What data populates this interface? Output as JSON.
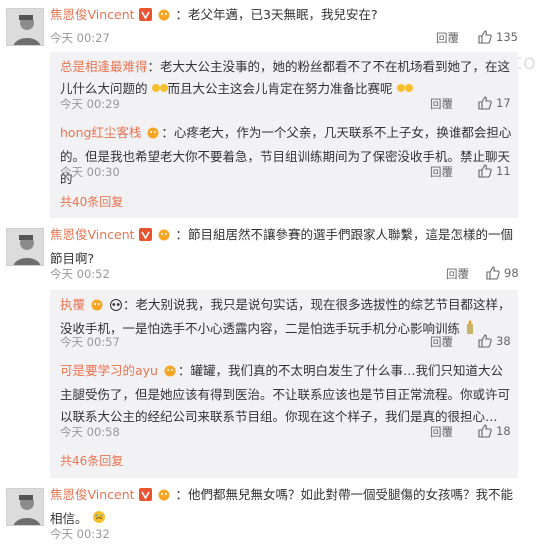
{
  "watermark": "tangchaowangyuechc.top",
  "labels": {
    "reply": "回覆"
  },
  "comments": [
    {
      "user": "焦恩俊Vincent",
      "text": "：老父年邁，已3天無眠，我兒安在?",
      "time": "今天 00:27",
      "likes": "135",
      "replies": [
        {
          "user": "总是相逢最难得",
          "text": "：老大大公主没事的，她的粉丝都看不了不在机场看到她了，在这儿什么大问题的",
          "text2": "而且大公主这会儿肯定在努力准备比赛呢",
          "time": "今天 00:29",
          "likes": "17"
        },
        {
          "user": "hong红尘客栈",
          "text": "：心疼老大，作为一个父亲，几天联系不上子女，换谁都会担心的。但是我也希望老大你不要着急，节目组训练期间为了保密没收手机。禁止聊天的",
          "time": "今天 00:30",
          "likes": "11"
        }
      ],
      "more": "共40条回复"
    },
    {
      "user": "焦恩俊Vincent",
      "text": "：節目組居然不讓參賽的選手們跟家人聯繫，這是怎樣的一個節目啊?",
      "time": "今天 00:52",
      "likes": "98",
      "replies": [
        {
          "user": "执覆",
          "text": "：老大别说我，我只是说句实话，现在很多选拔性的综艺节目都这样，没收手机，一是怕选手不小心透露内容，二是怕选手玩手机分心影响训练",
          "time": "今天 00:57",
          "likes": "38"
        },
        {
          "user": "可是要学习的ayu",
          "text": "：罐罐，我们真的不太明白发生了什么事…我们只知道大公主腿受伤了，但是她应该有得到医治。不让联系应该也是节目正常流程。你或许可以联系大公主的经纪公司来联系节目组。你现在这个样子，我们是真的很担心…",
          "time": "今天 00:58",
          "likes": "18"
        }
      ],
      "more": "共46条回复"
    },
    {
      "user": "焦恩俊Vincent",
      "text": "：他們都無兒無女嗎？如此對帶一個受腿傷的女孩嗎？我不能相信。",
      "time": "今天 00:32"
    }
  ]
}
